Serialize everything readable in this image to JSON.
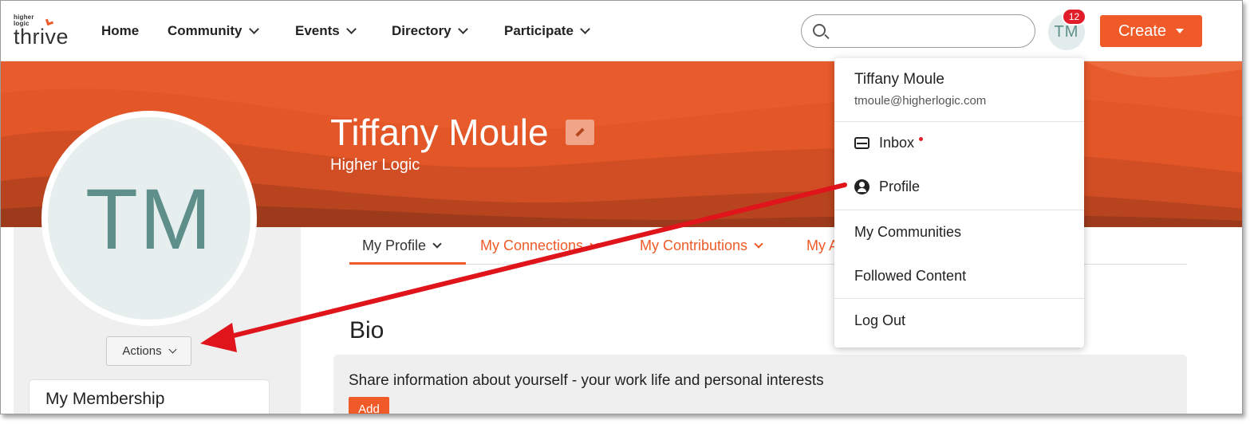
{
  "logo": {
    "small": "higher\nlogic",
    "main": "thrive"
  },
  "nav": {
    "items": [
      {
        "label": "Home",
        "has_dropdown": false
      },
      {
        "label": "Community",
        "has_dropdown": true
      },
      {
        "label": "Events",
        "has_dropdown": true
      },
      {
        "label": "Directory",
        "has_dropdown": true
      },
      {
        "label": "Participate",
        "has_dropdown": true
      }
    ]
  },
  "search": {
    "placeholder": ""
  },
  "user": {
    "initials": "TM",
    "notification_count": "12"
  },
  "create_button": {
    "label": "Create"
  },
  "profile": {
    "name": "Tiffany Moule",
    "organization": "Higher Logic",
    "initials": "TM"
  },
  "actions_button": {
    "label": "Actions"
  },
  "membership": {
    "title": "My Membership"
  },
  "tabs": [
    {
      "label": "My Profile",
      "active": true
    },
    {
      "label": "My Connections",
      "active": false
    },
    {
      "label": "My Contributions",
      "active": false
    },
    {
      "label": "My A",
      "active": false
    }
  ],
  "bio": {
    "title": "Bio",
    "prompt": "Share information about yourself - your work life and personal interests",
    "add_label": "Add"
  },
  "user_menu": {
    "name": "Tiffany Moule",
    "email": "tmoule@higherlogic.com",
    "items": [
      {
        "label": "Inbox",
        "icon": "inbox-icon",
        "unread": true
      },
      {
        "label": "Profile",
        "icon": "profile-icon"
      },
      {
        "label": "My Communities"
      },
      {
        "label": "Followed Content"
      },
      {
        "label": "Log Out"
      }
    ]
  },
  "colors": {
    "brand_orange": "#f05a28",
    "banner_orange": "#e85b2c",
    "avatar_teal": "#5e8f8a",
    "badge_red": "#e11d2a",
    "annotation_arrow": "#e0141b"
  }
}
